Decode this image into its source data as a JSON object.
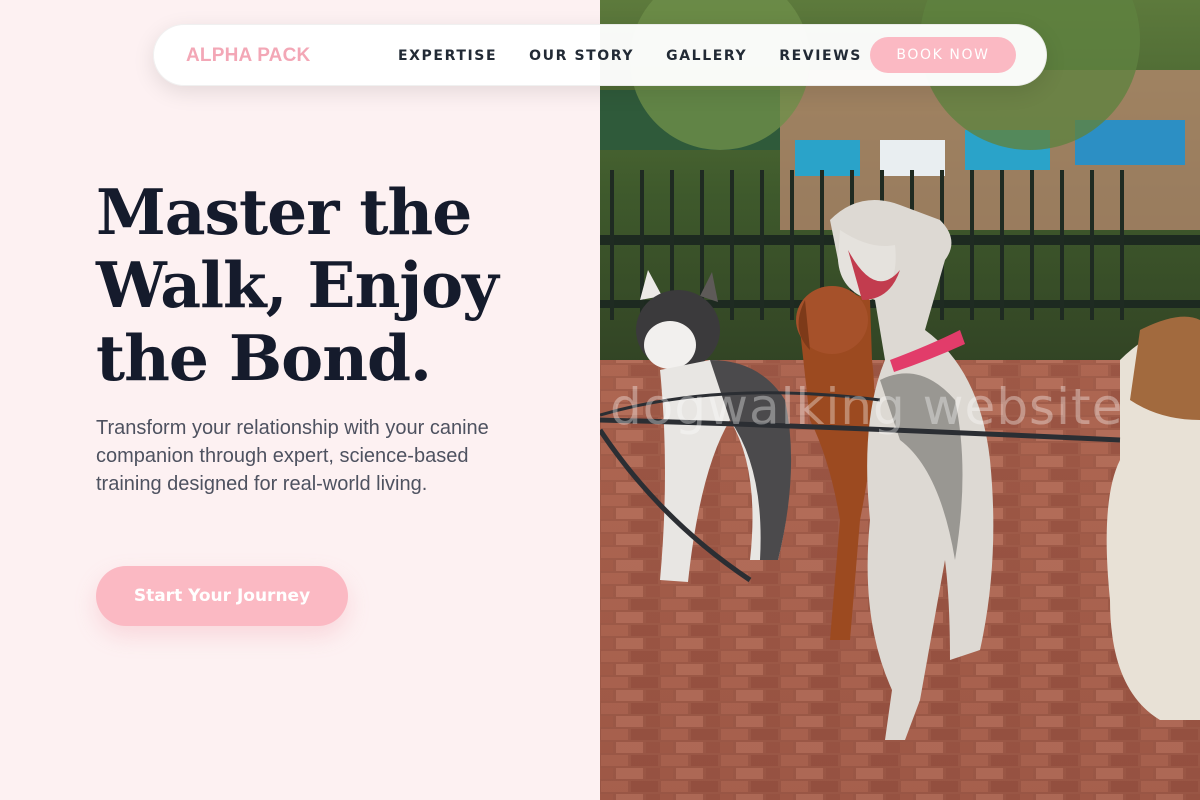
{
  "nav": {
    "brand": "ALPHA PACK",
    "links": [
      "EXPERTISE",
      "OUR STORY",
      "GALLERY",
      "REVIEWS"
    ],
    "cta": "BOOK NOW"
  },
  "hero": {
    "title_lines": [
      "Master the",
      "Walk, Enjoy",
      "the Bond."
    ],
    "subtitle": "Transform your relationship with your canine companion through expert, science-based training designed for real-world living.",
    "cta": "Start Your Journey"
  },
  "image": {
    "description_icon": "dog-pack-photo",
    "watermark": "dogwalking website"
  },
  "colors": {
    "background": "#fdf1f2",
    "accent_pink": "#fbb9c3",
    "brand_pink": "#f3a7b6",
    "heading": "#151b2c"
  }
}
